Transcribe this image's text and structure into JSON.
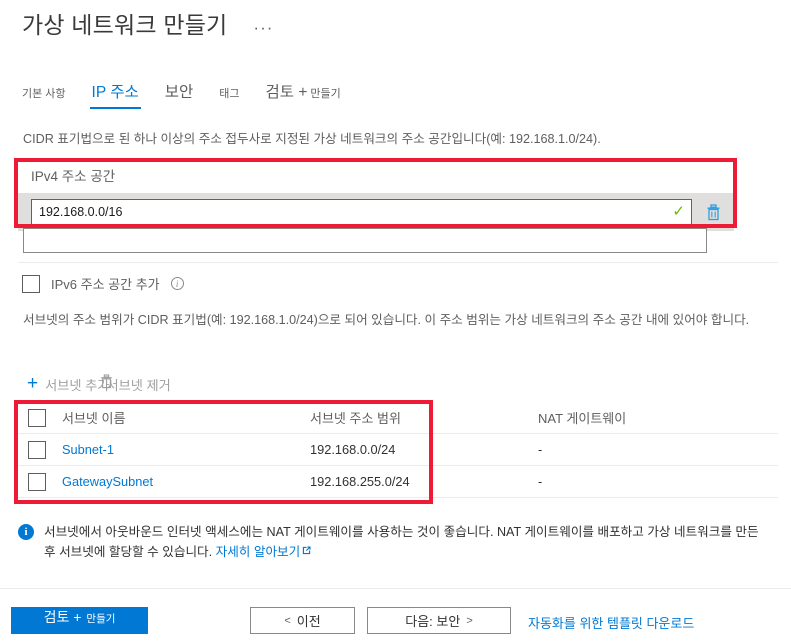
{
  "header": {
    "title": "가상 네트워크 만들기",
    "more_menu": "···"
  },
  "tabs": [
    {
      "label": "기본 사항",
      "active": false
    },
    {
      "label": "IP 주소",
      "active": true
    },
    {
      "label": "보안",
      "active": false
    },
    {
      "label": "태그",
      "active": false
    },
    {
      "label_primary": "검토 +",
      "label_secondary": "만들기",
      "active": false
    }
  ],
  "ipv4_section": {
    "description": "CIDR 표기법으로 된 하나 이상의 주소 접두사로 지정된 가상 네트워크의 주소 공간입니다(예: 192.168.1.0/24).",
    "label": "IPv4 주소 공간",
    "value": "192.168.0.0/16",
    "valid_icon": "checkmark-icon",
    "delete_icon": "trash-icon",
    "empty_input_value": "",
    "empty_input_placeholder": ""
  },
  "ipv6_checkbox": {
    "label": "IPv6 주소 공간 추가",
    "checked": false,
    "info_icon": "info-icon"
  },
  "subnet_section": {
    "description": "서브넷의 주소 범위가 CIDR 표기법(예: 192.168.1.0/24)으로 되어 있습니다. 이 주소 범위는 가상 네트워크의 주소 공간 내에 있어야 합니다.",
    "add_label": "서브넷 추가",
    "remove_label": "서브넷 제거",
    "add_icon": "plus-icon",
    "remove_icon": "trash-icon",
    "columns": [
      "서브넷 이름",
      "서브넷 주소 범위",
      "NAT 게이트웨이"
    ],
    "rows": [
      {
        "name": "Subnet-1",
        "range": "192.168.0.0/24",
        "nat": "-"
      },
      {
        "name": "GatewaySubnet",
        "range": "192.168.255.0/24",
        "nat": "-"
      }
    ]
  },
  "info_banner": {
    "icon": "info-icon",
    "text": "서브넷에서 아웃바운드 인터넷 액세스에는 NAT 게이트웨이를 사용하는 것이 좋습니다. NAT 게이트웨이를 배포하고 가상 네트워크를 만든 후 서브넷에 할당할 수 있습니다. ",
    "link_text": "자세히 알아보기",
    "link_icon": "external-link-icon"
  },
  "footer": {
    "create_primary": "검토 +",
    "create_secondary": "만들기",
    "previous": "이전",
    "previous_chevron": "<",
    "next": "다음: 보안",
    "next_chevron": ">",
    "template_link": "자동화를 위한 템플릿 다운로드"
  },
  "colors": {
    "accent": "#0078d4",
    "annotation": "#ed1b35",
    "valid": "#6bb700",
    "input_focus_border": "#8b3fa8",
    "row_bg": "#e1dfdd"
  }
}
